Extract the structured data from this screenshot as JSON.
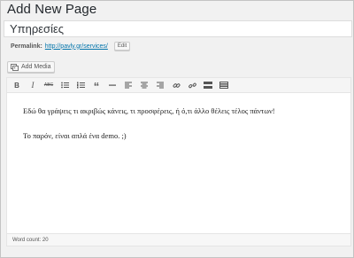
{
  "header": {
    "title": "Add New Page"
  },
  "title_field": {
    "value": "Υπηρεσίες"
  },
  "permalink": {
    "label": "Permalink:",
    "url": "http://pavly.gr/services/",
    "edit_label": "Edit"
  },
  "media": {
    "add_label": "Add Media",
    "icon": "media-icon"
  },
  "toolbar": {
    "buttons": [
      {
        "name": "bold",
        "glyph": "B"
      },
      {
        "name": "italic",
        "glyph": "I"
      },
      {
        "name": "strikethrough",
        "glyph": "ABC"
      },
      {
        "name": "bullet-list",
        "icon": "bullet-list-icon"
      },
      {
        "name": "numbered-list",
        "icon": "numbered-list-icon"
      },
      {
        "name": "blockquote",
        "glyph": "“"
      },
      {
        "name": "horizontal-line",
        "icon": "horizontal-line-icon"
      },
      {
        "name": "align-left",
        "icon": "align-left-icon"
      },
      {
        "name": "align-center",
        "icon": "align-center-icon"
      },
      {
        "name": "align-right",
        "icon": "align-right-icon"
      },
      {
        "name": "insert-link",
        "icon": "link-icon"
      },
      {
        "name": "remove-link",
        "icon": "unlink-icon"
      },
      {
        "name": "read-more",
        "icon": "read-more-icon"
      },
      {
        "name": "toolbar-toggle",
        "icon": "toolbar-toggle-icon"
      }
    ]
  },
  "content": {
    "paragraphs": [
      "Εδώ θα γράψεις τι ακριβώς κάνεις, τι προσφέρεις, ή ό,τι άλλο θέλεις τέλος πάντων!",
      "Το παρόν, είναι απλά ένα demo. ;)"
    ]
  },
  "status": {
    "word_count": "Word count: 20"
  }
}
